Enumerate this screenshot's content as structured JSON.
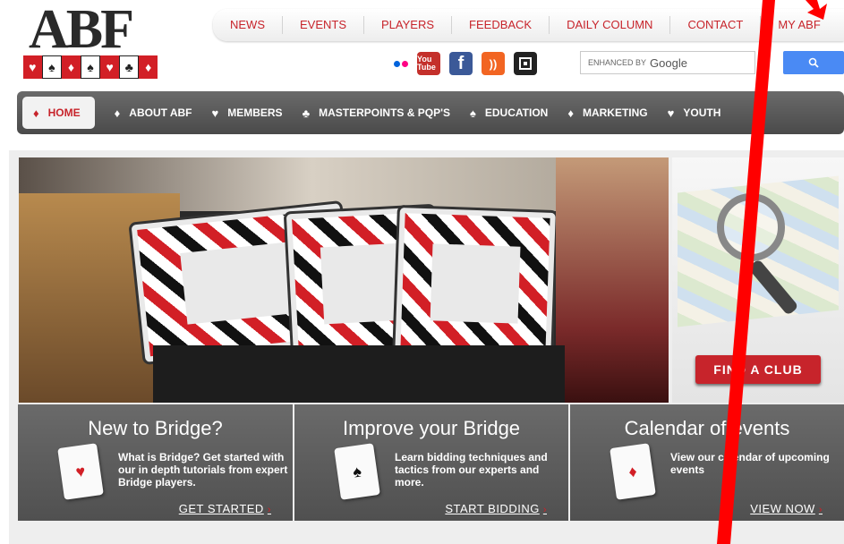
{
  "logo": {
    "text": "ABF",
    "suits": [
      "♥",
      "♠",
      "♦",
      "♠",
      "♥",
      "♣",
      "♦"
    ]
  },
  "topnav": [
    "NEWS",
    "EVENTS",
    "PLAYERS",
    "FEEDBACK",
    "DAILY COLUMN",
    "CONTACT",
    "MY ABF"
  ],
  "social": {
    "youtube_label": "You Tube",
    "facebook_label": "f",
    "rss_label": "))"
  },
  "search": {
    "placeholder_prefix": "ENHANCED BY",
    "placeholder_brand": "Google"
  },
  "mainnav": [
    {
      "suit": "♦",
      "label": "HOME"
    },
    {
      "suit": "♦",
      "label": "ABOUT ABF"
    },
    {
      "suit": "♥",
      "label": "MEMBERS"
    },
    {
      "suit": "♣",
      "label": "MASTERPOINTS & PQP'S"
    },
    {
      "suit": "♠",
      "label": "EDUCATION"
    },
    {
      "suit": "♦",
      "label": "MARKETING"
    },
    {
      "suit": "♥",
      "label": "YOUTH"
    }
  ],
  "club": {
    "button": "FIND A CLUB"
  },
  "panels": [
    {
      "title": "New to Bridge?",
      "suit": "♥",
      "suit_color": "#d21f26",
      "text": "What is Bridge? Get started with our in depth tutorials from expert Bridge players.",
      "cta": "GET STARTED"
    },
    {
      "title": "Improve your Bridge",
      "suit": "♠",
      "suit_color": "#111111",
      "text": "Learn bidding techniques and tactics from our experts and more.",
      "cta": "START BIDDING"
    },
    {
      "title": "Calendar of events",
      "suit": "♦",
      "suit_color": "#d21f26",
      "text": "View our calendar of upcoming events",
      "cta": "VIEW NOW"
    }
  ],
  "colors": {
    "brand_red": "#c7242b",
    "nav_gray": "#555555",
    "search_blue": "#4a8af4",
    "annotation_red": "#ff0000"
  },
  "icons": [
    "flickr-icon",
    "youtube-icon",
    "facebook-icon",
    "rss-icon",
    "share-icon",
    "search-icon"
  ]
}
